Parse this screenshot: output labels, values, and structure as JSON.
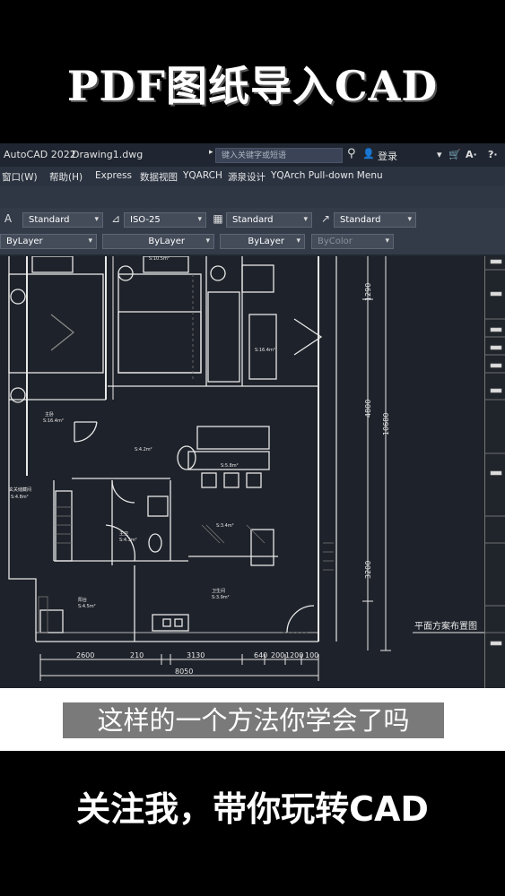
{
  "overlay": {
    "top_title": "PDF图纸导入CAD",
    "caption": "这样的一个方法你学会了吗",
    "bottom_title": "关注我，带你玩转CAD"
  },
  "titlebar": {
    "app": "AutoCAD 2022",
    "file": "Drawing1.dwg",
    "search_placeholder": "键入关键字或短语",
    "login": "登录"
  },
  "menu": [
    "窗口(W)",
    "帮助(H)",
    "Express",
    "数据视图",
    "YQARCH",
    "源泉设计",
    "YQArch Pull-down Menu"
  ],
  "toolbar": {
    "text_style": "Standard",
    "dim_style": "ISO-25",
    "table_style": "Standard",
    "multileader_style": "Standard",
    "layer": "ByLayer",
    "linetype": "ByLayer",
    "lineweight": "ByLayer",
    "color": "ByColor"
  },
  "drawing": {
    "dims_bottom": [
      "2600",
      "210",
      "3130",
      "640",
      "200",
      "1200",
      "100"
    ],
    "total_width": "8050",
    "dims_right": [
      "1290",
      "4800",
      "10680",
      "3200"
    ],
    "title": "平面方案布置图",
    "room_labels": [
      "S:16.4m²",
      "S:10.5m²",
      "S:16.4m²",
      "S:4.2m²",
      "S:5.8m²",
      "S:4.8m²",
      "S:4.3m²",
      "S:3.4m²",
      "S:3.9m²",
      "S:4.5m²"
    ],
    "room_names": [
      "主卧",
      "次卧",
      "卧室",
      "客厅",
      "餐厅",
      "玄关储藏间",
      "主卫",
      "厨房",
      "卫生间",
      "阳台"
    ]
  }
}
